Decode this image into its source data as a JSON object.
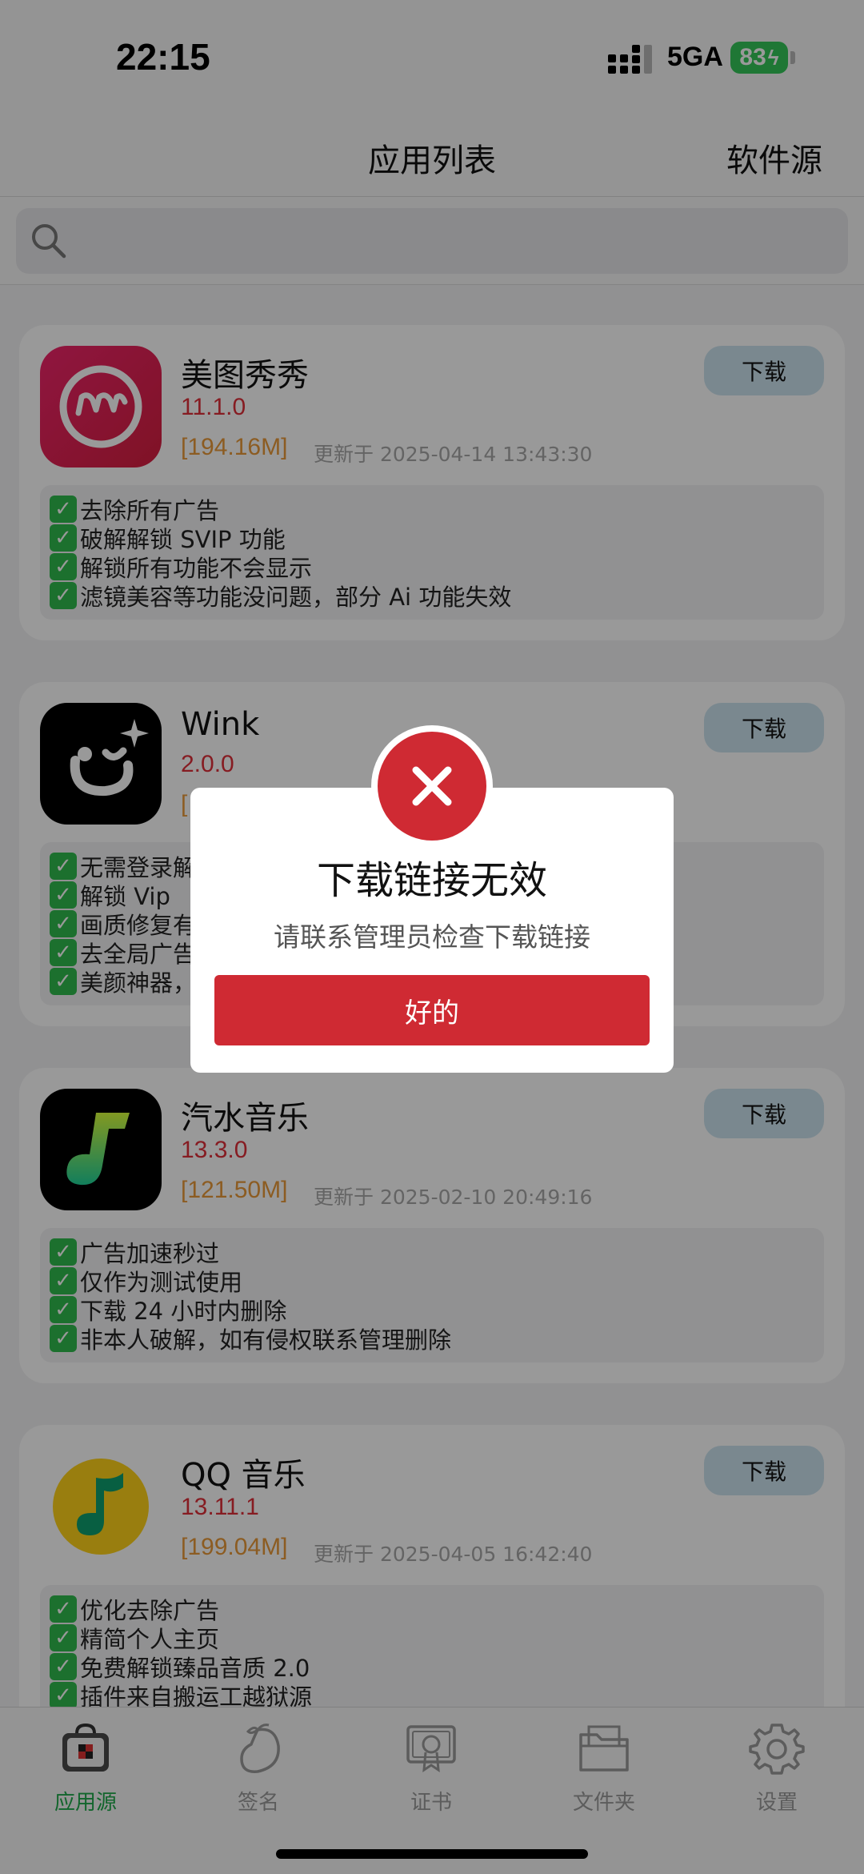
{
  "status_bar": {
    "time": "22:15",
    "network": "5GA",
    "battery": "83"
  },
  "nav": {
    "title": "应用列表",
    "right_action": "软件源"
  },
  "search": {
    "placeholder": ""
  },
  "apps": [
    {
      "name": "美图秀秀",
      "version": "11.1.0",
      "size": "[194.16M]",
      "updated": "更新于 2025-04-14 13:43:30",
      "download_label": "下载",
      "icon": "meitu-icon",
      "notes": [
        "去除所有广告",
        "破解解锁 SVIP 功能",
        "解锁所有功能不会显示",
        "滤镜美容等功能没问题，部分 Ai 功能失效"
      ]
    },
    {
      "name": "Wink",
      "version": "2.0.0",
      "size": "[",
      "updated": "",
      "download_label": "下载",
      "icon": "wink-icon",
      "notes": [
        "无需登录解",
        "解锁 Vip",
        "画质修复有",
        "去全局广告",
        "美颜神器，"
      ]
    },
    {
      "name": "汽水音乐",
      "version": "13.3.0",
      "size": "[121.50M]",
      "updated": "更新于 2025-02-10 20:49:16",
      "download_label": "下载",
      "icon": "qishui-music-icon",
      "notes": [
        "广告加速秒过",
        "仅作为测试使用",
        "下载 24 小时内删除",
        "非本人破解，如有侵权联系管理删除"
      ]
    },
    {
      "name": "QQ 音乐",
      "version": "13.11.1",
      "size": "[199.04M]",
      "updated": "更新于 2025-04-05 16:42:40",
      "download_label": "下载",
      "icon": "qq-music-icon",
      "notes": [
        "优化去除广告",
        "精简个人主页",
        "免费解锁臻品音质 2.0",
        "插件来自搬运工越狱源"
      ]
    }
  ],
  "check_mark": "✓",
  "dialog": {
    "title": "下载链接无效",
    "message": "请联系管理员检查下载链接",
    "confirm_label": "好的"
  },
  "tabs": [
    {
      "label": "应用源",
      "icon": "app-source-icon",
      "active": true
    },
    {
      "label": "签名",
      "icon": "mango-sign-icon",
      "active": false
    },
    {
      "label": "证书",
      "icon": "certificate-icon",
      "active": false
    },
    {
      "label": "文件夹",
      "icon": "folder-icon",
      "active": false
    },
    {
      "label": "设置",
      "icon": "settings-gear-icon",
      "active": false
    }
  ],
  "colors": {
    "accent_red": "#cf2a33",
    "active_tab_green": "#1fa84a",
    "version_red": "#e0303a",
    "size_orange": "#e99a3a",
    "download_button_bg": "#cbe3ee"
  }
}
